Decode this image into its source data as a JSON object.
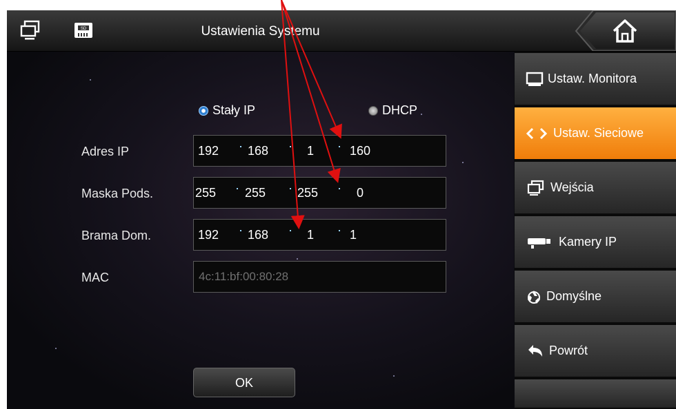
{
  "header": {
    "title": "Ustawienia Systemu",
    "left_icons": [
      "monitor-icon",
      "sd-card-icon"
    ],
    "right_icon": "home-icon"
  },
  "network": {
    "mode_options": [
      {
        "label": "Stały IP",
        "selected": true
      },
      {
        "label": "DHCP",
        "selected": false
      }
    ],
    "fields": [
      {
        "label": "Adres IP",
        "octets": [
          "192",
          "168",
          "1",
          "160"
        ]
      },
      {
        "label": "Maska Pods.",
        "octets": [
          "255",
          "255",
          "255",
          "0"
        ]
      },
      {
        "label": "Brama Dom.",
        "octets": [
          "192",
          "168",
          "1",
          "1"
        ]
      }
    ],
    "mac": {
      "label": "MAC",
      "value": "4c:11:bf:00:80:28"
    },
    "ok_label": "OK"
  },
  "sidebar": {
    "items": [
      {
        "label": "Ustaw. Monitora",
        "icon": "monitor-icon",
        "active": false
      },
      {
        "label": "Ustaw. Sieciowe",
        "icon": "network-arrows-icon",
        "active": true
      },
      {
        "label": "Wejścia",
        "icon": "inputs-icon",
        "active": false
      },
      {
        "label": "Kamery IP",
        "icon": "camera-icon",
        "active": false
      },
      {
        "label": "Domyślne",
        "icon": "recycle-icon",
        "active": false
      },
      {
        "label": "Powrót",
        "icon": "back-icon",
        "active": false
      }
    ]
  },
  "colors": {
    "active_item": "#f08a16",
    "annotation_arrow": "#e01010",
    "radio_selected": "#2f7fd0"
  }
}
